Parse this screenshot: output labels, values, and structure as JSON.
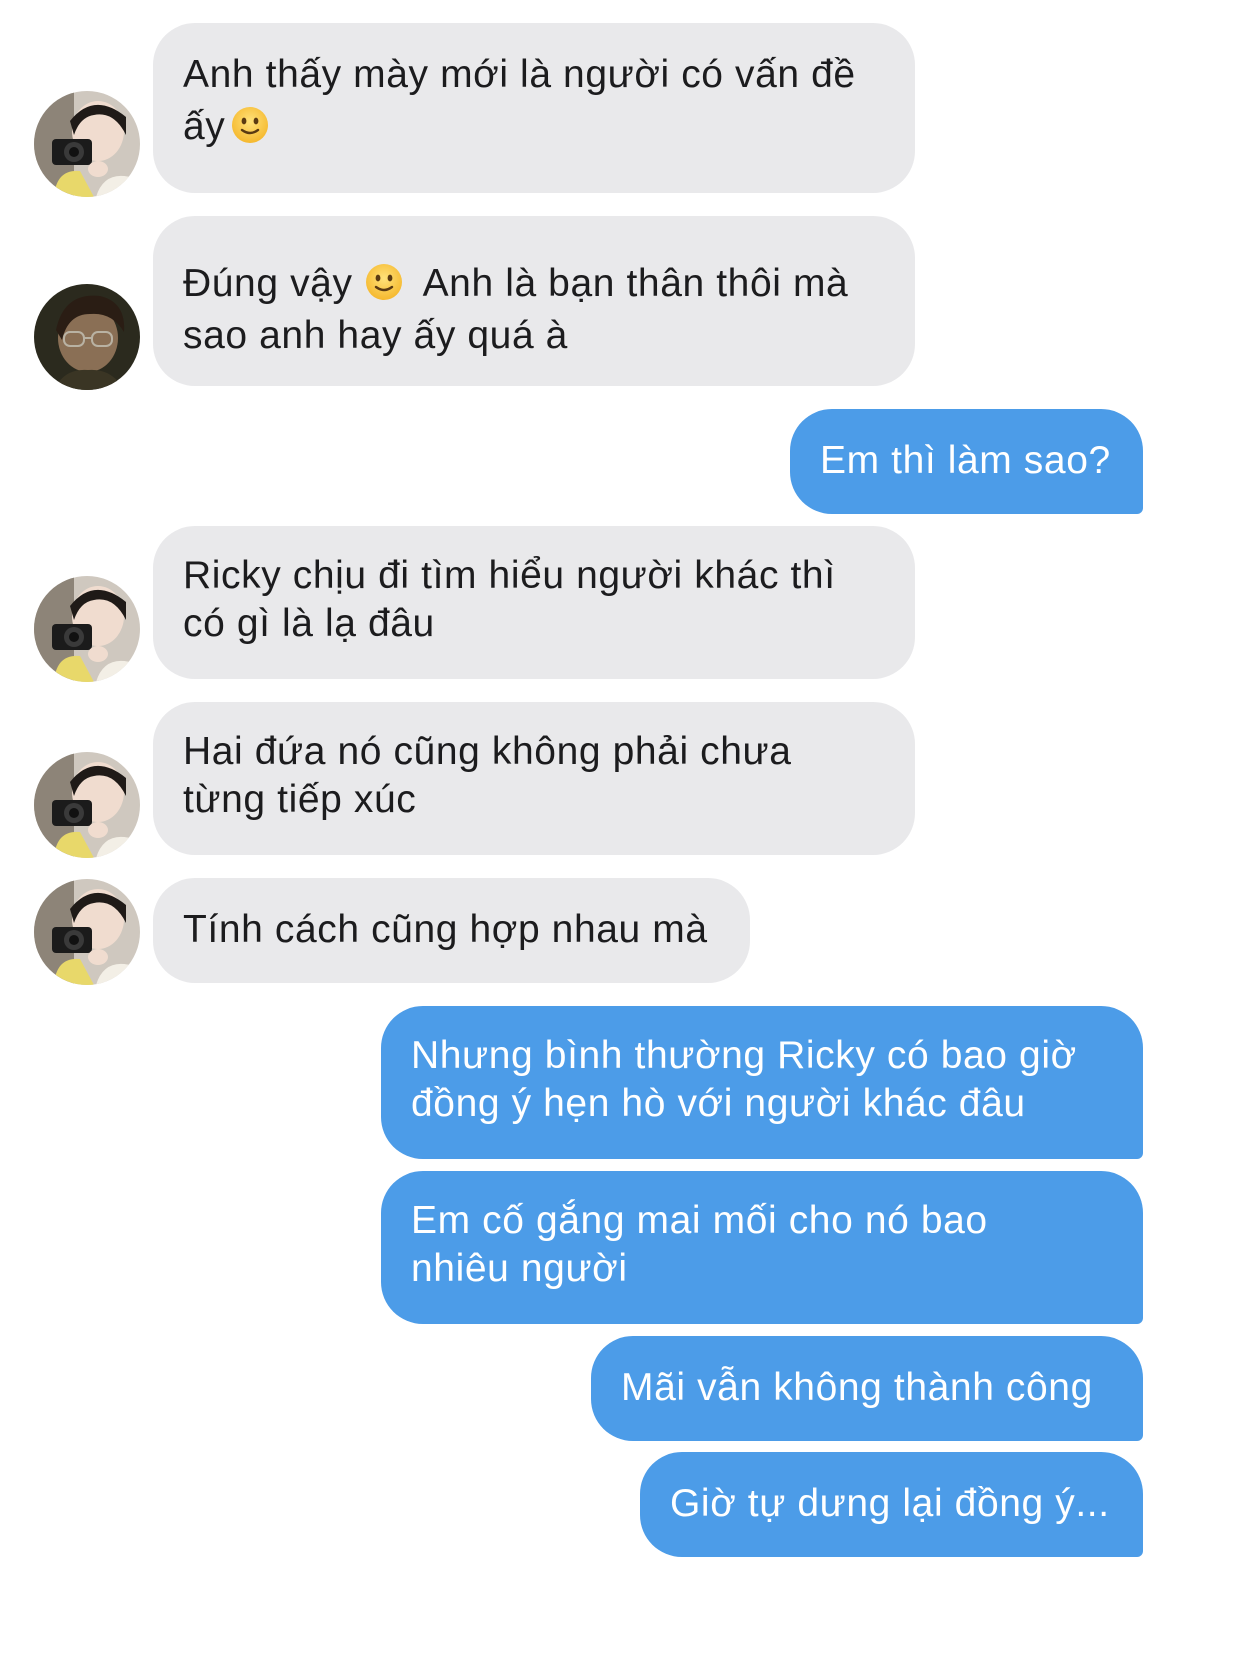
{
  "conversation": {
    "messages": [
      {
        "sender": "friend",
        "avatar": "avatar-camera",
        "lines": [
          "Anh thấy mày mới là người có vấn đề",
          "ấy"
        ],
        "emoji": "slightly-smiling-face-icon"
      },
      {
        "sender": "friend2",
        "avatar": "avatar-glasses",
        "line1_a": "Đúng vậy",
        "line1_b": "Anh là bạn thân thôi mà",
        "line2": "sao anh hay ấy quá à",
        "emoji": "slightly-smiling-face-icon"
      },
      {
        "sender": "me",
        "lines": [
          "Em thì làm sao?"
        ]
      },
      {
        "sender": "friend",
        "avatar": "avatar-camera",
        "lines": [
          "Ricky chịu đi tìm hiểu người khác thì",
          "có gì là lạ đâu"
        ]
      },
      {
        "sender": "friend",
        "avatar": "avatar-camera",
        "lines": [
          "Hai đứa nó cũng không phải chưa",
          "từng tiếp xúc"
        ]
      },
      {
        "sender": "friend",
        "avatar": "avatar-camera",
        "lines": [
          "Tính cách cũng hợp nhau mà"
        ]
      },
      {
        "sender": "me",
        "lines": [
          "Nhưng bình thường Ricky có bao giờ",
          "đồng ý hẹn hò với người khác đâu"
        ]
      },
      {
        "sender": "me",
        "lines": [
          "Em cố gắng mai mối cho nó bao",
          "nhiêu người"
        ]
      },
      {
        "sender": "me",
        "lines": [
          "Mãi vẫn không thành công"
        ]
      },
      {
        "sender": "me",
        "lines": [
          "Giờ tự dưng lại đồng ý..."
        ]
      }
    ]
  },
  "colors": {
    "incoming_bubble": "#e9e9eb",
    "outgoing_bubble": "#4c9ce8",
    "incoming_text": "#1c1c1e",
    "outgoing_text": "#ffffff"
  }
}
